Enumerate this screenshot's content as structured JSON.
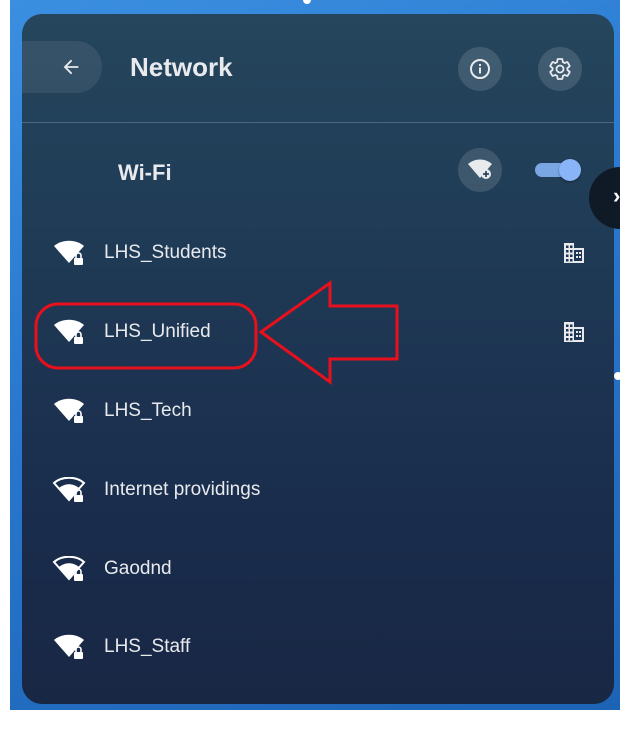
{
  "header": {
    "title": "Network"
  },
  "wifi": {
    "label": "Wi-Fi",
    "enabled": true
  },
  "networks": [
    {
      "name": "LHS_Students",
      "secured": true,
      "managed": true,
      "signal_icon": "wifi-full-icon"
    },
    {
      "name": "LHS_Unified",
      "secured": true,
      "managed": true,
      "signal_icon": "wifi-full-icon"
    },
    {
      "name": "LHS_Tech",
      "secured": true,
      "managed": false,
      "signal_icon": "wifi-full-icon"
    },
    {
      "name": "Internet providings",
      "secured": true,
      "managed": false,
      "signal_icon": "wifi-partial-icon"
    },
    {
      "name": "Gaodnd",
      "secured": true,
      "managed": false,
      "signal_icon": "wifi-partial-icon"
    },
    {
      "name": "LHS_Staff",
      "secured": true,
      "managed": false,
      "signal_icon": "wifi-full-icon"
    }
  ],
  "colors": {
    "accent": "#8ab4f8",
    "annotation": "#e8101c",
    "panel_top": "#25465d",
    "panel_bottom": "#182744"
  },
  "icons": {
    "back": "back-arrow-icon",
    "info": "info-icon",
    "settings": "gear-icon",
    "add_wifi": "add-wifi-icon",
    "managed": "building-icon",
    "expand": "chevron-right-icon"
  }
}
